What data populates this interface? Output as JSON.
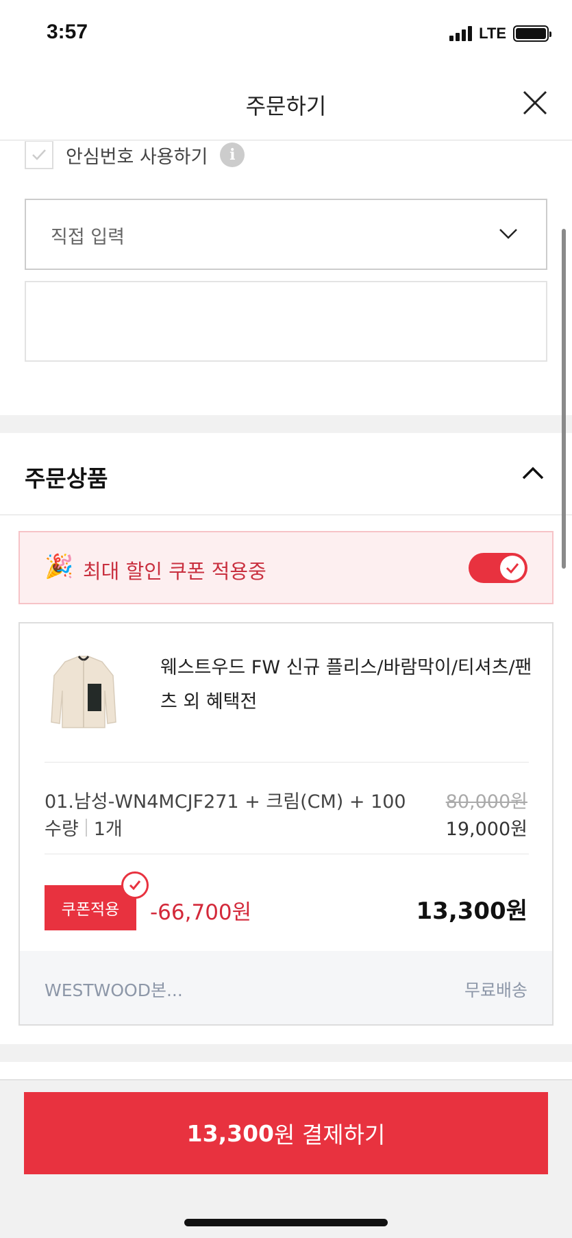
{
  "status": {
    "time": "3:57",
    "network": "LTE"
  },
  "nav": {
    "title": "주문하기",
    "close_icon": "close-icon"
  },
  "safe_number": {
    "label": "안심번호 사용하기",
    "checked": true,
    "info_icon": "info-icon"
  },
  "delivery_memo": {
    "selected": "직접 입력",
    "textarea_value": ""
  },
  "order_section": {
    "title": "주문상품",
    "expanded": true
  },
  "coupon_banner": {
    "icon": "party-popper-icon",
    "emoji": "🎉",
    "text": "최대 할인 쿠폰 적용중",
    "toggle_on": true
  },
  "product": {
    "name": "웨스트우드 FW 신규 플리스/바람막이/티셔츠/팬츠 외 혜택전",
    "option": "01.남성-WN4MCJF271 + 크림(CM) + 100",
    "qty_label": "수량",
    "qty_value": "1개",
    "original_price": "80,000원",
    "sale_price": "19,000원",
    "coupon_label": "쿠폰적용",
    "discount": "-66,700원",
    "final_price": "13,300원",
    "seller": "WESTWOOD본...",
    "shipping": "무료배송"
  },
  "pay_button": {
    "amount": "13,300",
    "suffix": "원 결제하기"
  },
  "colors": {
    "accent": "#e8323f",
    "coupon_bg": "#fdeff0",
    "footer_bg": "#f5f6f8"
  }
}
